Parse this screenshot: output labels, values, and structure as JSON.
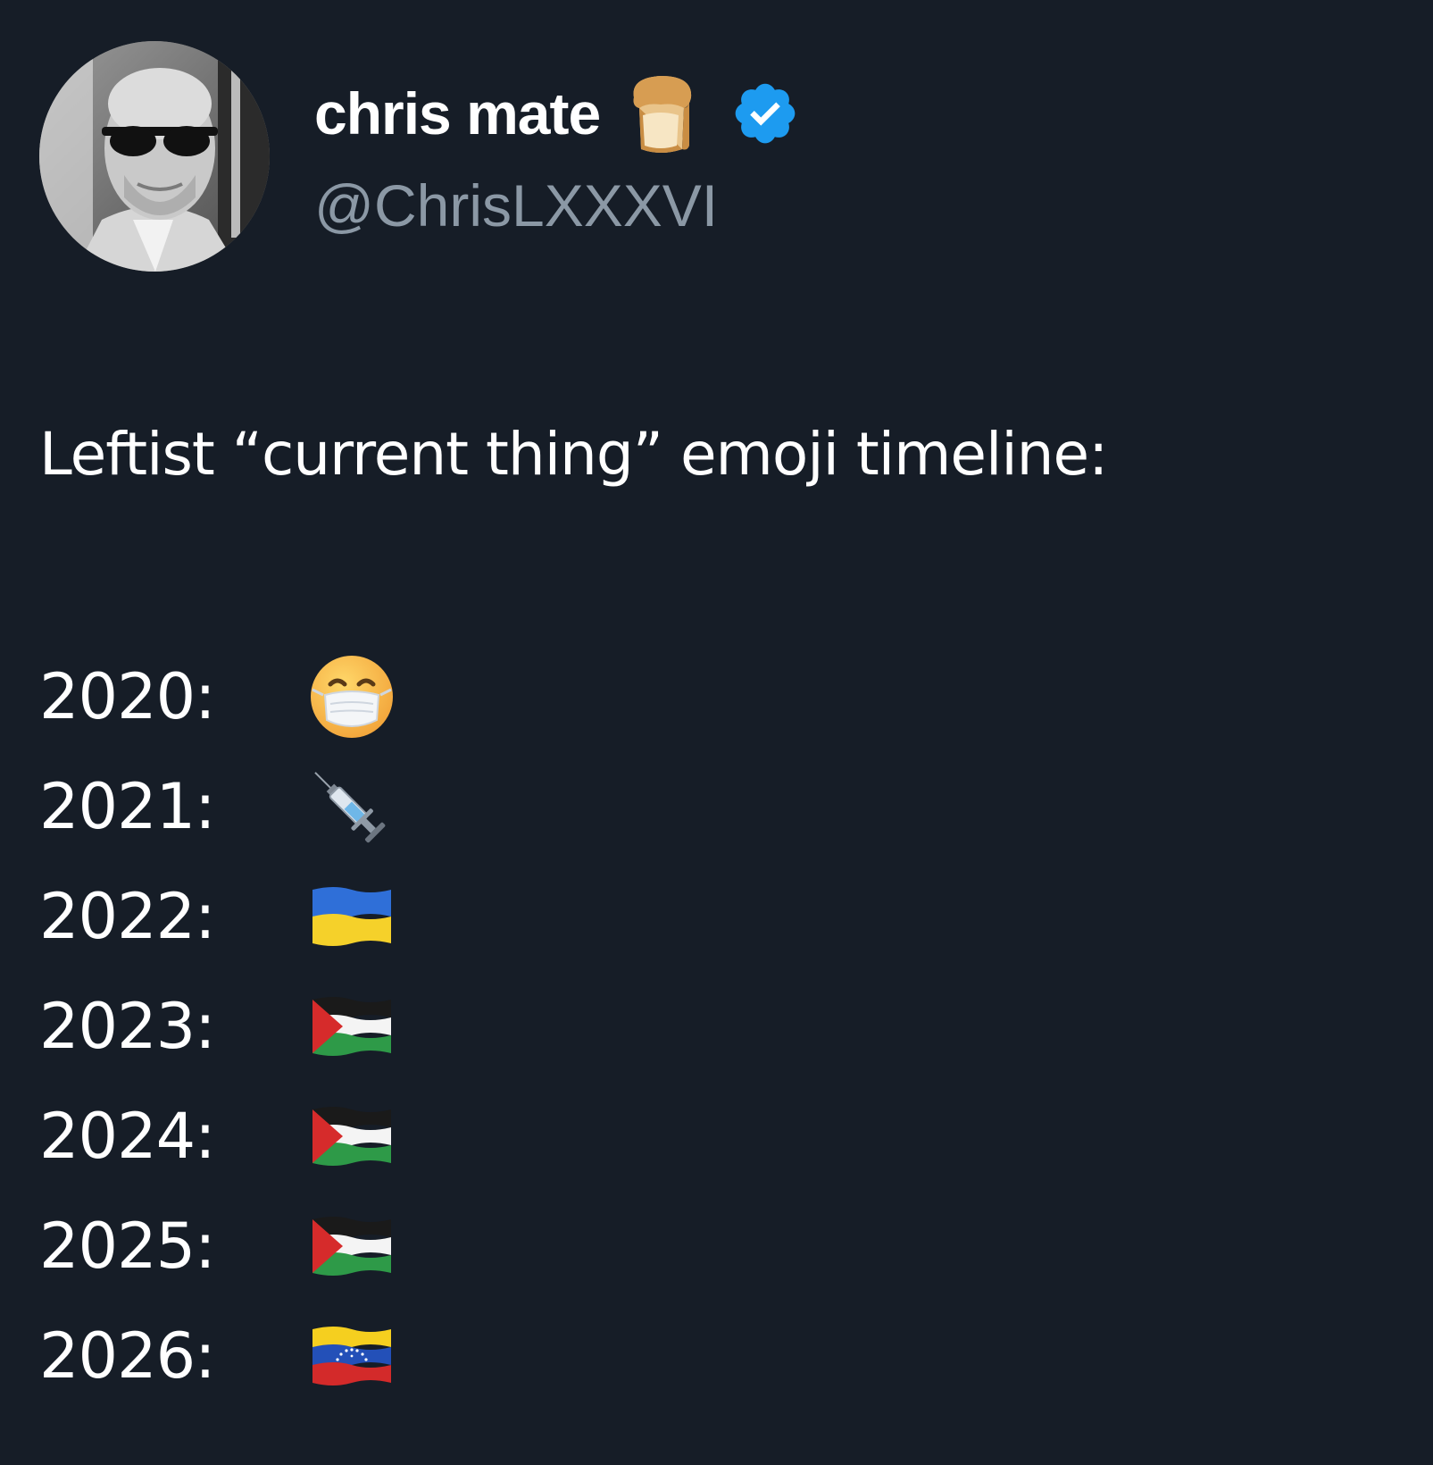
{
  "author": {
    "display_name": "chris mate",
    "handle": "@ChrisLXXXVI",
    "name_emoji": "bread-icon",
    "verified_badge": "verified-icon",
    "badge_color": "#1d9bf0"
  },
  "tweet": {
    "headline": "Leftist “current thing” emoji timeline:",
    "timeline": [
      {
        "year": "2020:",
        "emoji": "face-with-medical-mask-icon"
      },
      {
        "year": "2021:",
        "emoji": "syringe-icon"
      },
      {
        "year": "2022:",
        "emoji": "ukraine-flag-icon"
      },
      {
        "year": "2023:",
        "emoji": "palestine-flag-icon"
      },
      {
        "year": "2024:",
        "emoji": "palestine-flag-icon"
      },
      {
        "year": "2025:",
        "emoji": "palestine-flag-icon"
      },
      {
        "year": "2026:",
        "emoji": "venezuela-flag-icon"
      }
    ]
  },
  "colors": {
    "background": "#161d27",
    "text": "#ffffff",
    "secondary_text": "#8b98a5"
  }
}
